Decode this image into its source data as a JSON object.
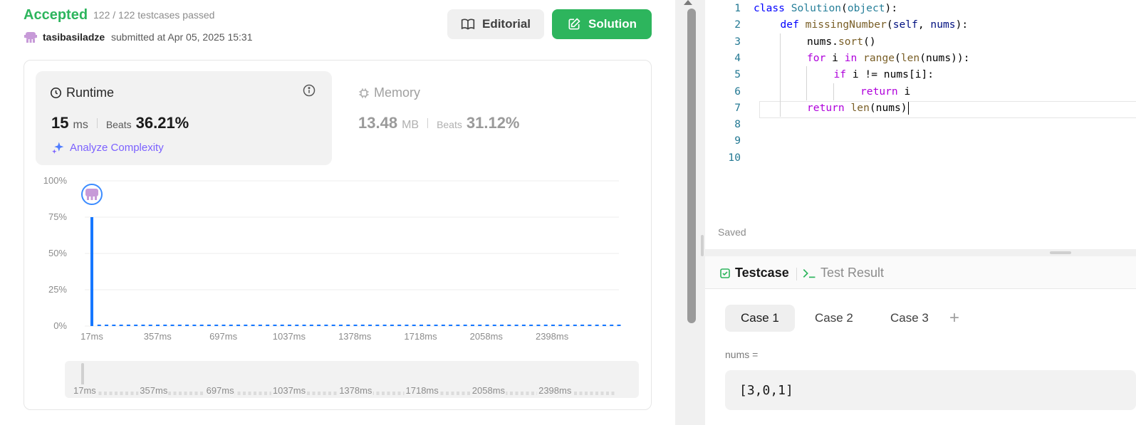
{
  "submission": {
    "status": "Accepted",
    "testcases": "122 / 122 testcases passed",
    "user": "tasibasiladze",
    "submitted_at": "submitted at Apr 05, 2025 15:31"
  },
  "buttons": {
    "editorial": "Editorial",
    "solution": "Solution"
  },
  "runtime": {
    "label": "Runtime",
    "value": "15",
    "unit": "ms",
    "beats_label": "Beats",
    "beats": "36.21%",
    "analyze": "Analyze Complexity"
  },
  "memory": {
    "label": "Memory",
    "value": "13.48",
    "unit": "MB",
    "beats_label": "Beats",
    "beats": "31.12%"
  },
  "chart_data": {
    "type": "bar",
    "y_ticks": [
      "100%",
      "75%",
      "50%",
      "25%",
      "0%"
    ],
    "ylim": [
      0,
      100
    ],
    "x_tick_labels": [
      "17ms",
      "357ms",
      "697ms",
      "1037ms",
      "1378ms",
      "1718ms",
      "2058ms",
      "2398ms"
    ],
    "highlight_value": 75,
    "bar_count": 73,
    "other_bar_value": 1,
    "colors": {
      "bar": "#1677ff",
      "grid": "#eeeeee",
      "tick": "#8c8c8c"
    }
  },
  "mini_chart": {
    "x_tick_labels": [
      "17ms",
      "357ms",
      "697ms",
      "1037ms",
      "1378ms",
      "1718ms",
      "2058ms",
      "2398ms"
    ]
  },
  "editor": {
    "lines": [
      {
        "n": "1",
        "indent": 0,
        "tokens": [
          [
            "kw",
            "class"
          ],
          [
            "",
            "",
            " "
          ],
          [
            "cls",
            "Solution"
          ],
          [
            "",
            "("
          ],
          [
            "cls",
            "object"
          ],
          [
            "",
            "):"
          ]
        ]
      },
      {
        "n": "2",
        "indent": 1,
        "tokens": [
          [
            "kw",
            "def"
          ],
          [
            "",
            " "
          ],
          [
            "fn",
            "missingNumber"
          ],
          [
            "",
            "("
          ],
          [
            "param",
            "self"
          ],
          [
            "",
            ", "
          ],
          [
            "param",
            "nums"
          ],
          [
            "",
            "):"
          ]
        ]
      },
      {
        "n": "3",
        "indent": 2,
        "tokens": [
          [
            "",
            "nums."
          ],
          [
            "fn",
            "sort"
          ],
          [
            "",
            "()"
          ]
        ]
      },
      {
        "n": "4",
        "indent": 2,
        "tokens": [
          [
            "kw2",
            "for"
          ],
          [
            "",
            " i "
          ],
          [
            "kw2",
            "in"
          ],
          [
            "",
            " "
          ],
          [
            "fn",
            "range"
          ],
          [
            "",
            "("
          ],
          [
            "fn",
            "len"
          ],
          [
            "",
            "(nums)):"
          ]
        ]
      },
      {
        "n": "5",
        "indent": 3,
        "tokens": [
          [
            "kw2",
            "if"
          ],
          [
            "",
            " i != nums[i]:"
          ]
        ]
      },
      {
        "n": "6",
        "indent": 4,
        "tokens": [
          [
            "kw2",
            "return"
          ],
          [
            "",
            " i"
          ]
        ]
      },
      {
        "n": "7",
        "indent": 2,
        "tokens": [
          [
            "kw2",
            "return"
          ],
          [
            "",
            " "
          ],
          [
            "fn",
            "len"
          ],
          [
            "",
            "(nums)"
          ]
        ]
      },
      {
        "n": "8",
        "indent": 0,
        "tokens": []
      },
      {
        "n": "9",
        "indent": 0,
        "tokens": []
      },
      {
        "n": "10",
        "indent": 0,
        "tokens": []
      }
    ],
    "status": "Saved"
  },
  "test_panel": {
    "tab_testcase": "Testcase",
    "tab_result": "Test Result",
    "cases": [
      "Case 1",
      "Case 2",
      "Case 3"
    ],
    "add": "+",
    "field_label": "nums =",
    "field_value": "[3,0,1]"
  }
}
